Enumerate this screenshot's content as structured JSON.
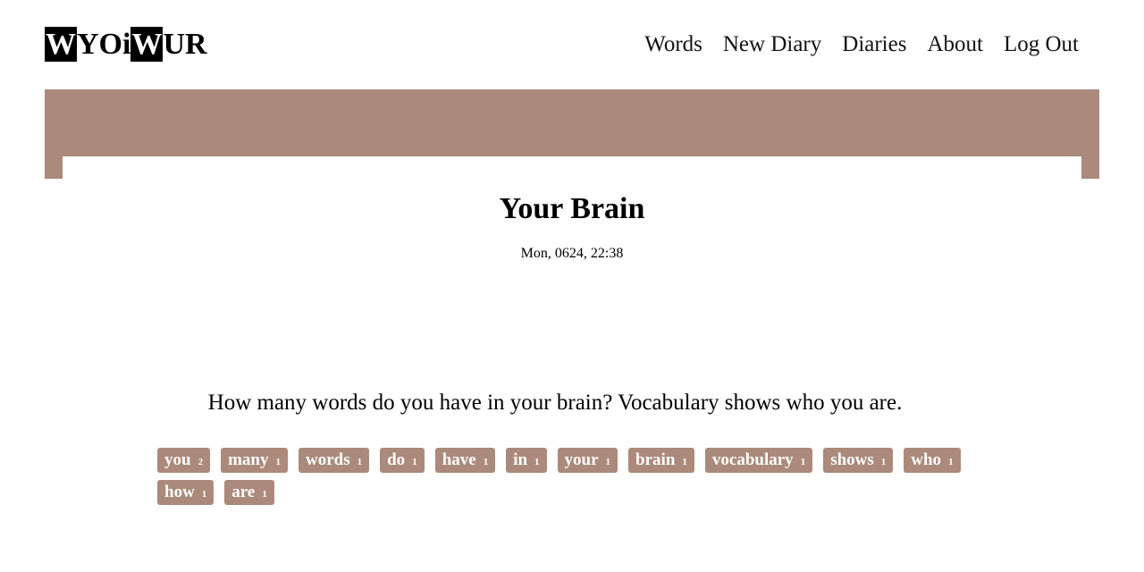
{
  "header": {
    "logo_parts": [
      "W",
      "YOi",
      "W",
      "UR"
    ],
    "nav": [
      "Words",
      "New Diary",
      "Diaries",
      "About",
      "Log Out"
    ]
  },
  "diary": {
    "title": "Your Brain",
    "date": "Mon, 0624, 22:38",
    "sentence": "How many words do you have in your brain? Vocabulary shows who you are."
  },
  "words": [
    {
      "word": "you",
      "count": "2"
    },
    {
      "word": "many",
      "count": "1"
    },
    {
      "word": "words",
      "count": "1"
    },
    {
      "word": "do",
      "count": "1"
    },
    {
      "word": "have",
      "count": "1"
    },
    {
      "word": "in",
      "count": "1"
    },
    {
      "word": "your",
      "count": "1"
    },
    {
      "word": "brain",
      "count": "1"
    },
    {
      "word": "vocabulary",
      "count": "1"
    },
    {
      "word": "shows",
      "count": "1"
    },
    {
      "word": "who",
      "count": "1"
    },
    {
      "word": "how",
      "count": "1"
    },
    {
      "word": "are",
      "count": "1"
    }
  ],
  "colors": {
    "accent": "#ab8a7b"
  }
}
